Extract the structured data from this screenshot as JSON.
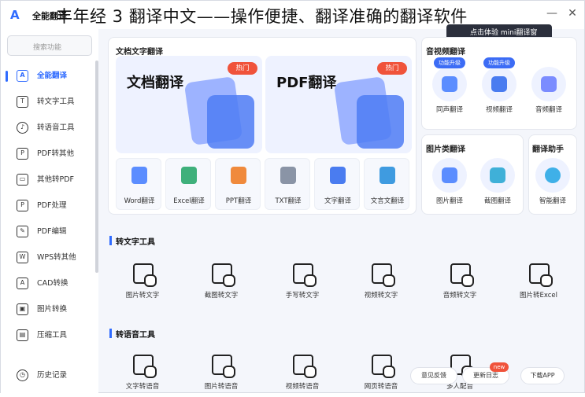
{
  "app": {
    "name": "全能翻译",
    "logo": "A",
    "overlay_title": "丰年经 3 翻译中文——操作便捷、翻译准确的翻译软件",
    "trial_label": "点击体验 mini翻译窗"
  },
  "window": {
    "minimize": "—",
    "close": "✕"
  },
  "sidebar": {
    "search_placeholder": "搜索功能",
    "items": [
      {
        "label": "全能翻译",
        "icon": "translate-icon"
      },
      {
        "label": "转文字工具",
        "icon": "text-tool-icon"
      },
      {
        "label": "转语音工具",
        "icon": "voice-icon"
      },
      {
        "label": "PDF转其他",
        "icon": "pdf-icon"
      },
      {
        "label": "其他转PDF",
        "icon": "file-to-pdf-icon"
      },
      {
        "label": "PDF处理",
        "icon": "pdf-process-icon"
      },
      {
        "label": "PDF编辑",
        "icon": "pdf-edit-icon"
      },
      {
        "label": "WPS转其他",
        "icon": "wps-icon"
      },
      {
        "label": "CAD转换",
        "icon": "cad-icon"
      },
      {
        "label": "图片转换",
        "icon": "image-icon"
      },
      {
        "label": "压缩工具",
        "icon": "compress-icon"
      },
      {
        "label": "历史记录",
        "icon": "history-icon"
      }
    ]
  },
  "doc_panel": {
    "title": "文档文字翻译",
    "cards": [
      {
        "title": "文档翻译",
        "badge": "热门"
      },
      {
        "title": "PDF翻译",
        "badge": "热门"
      }
    ],
    "tools": [
      "Word翻译",
      "Excel翻译",
      "PPT翻译",
      "TXT翻译",
      "文字翻译",
      "文言文翻译"
    ]
  },
  "av_panel": {
    "title": "音视频翻译",
    "items": [
      {
        "label": "同声翻译",
        "tag": "功能升级"
      },
      {
        "label": "视频翻译",
        "tag": "功能升级"
      },
      {
        "label": "音频翻译",
        "tag": ""
      }
    ]
  },
  "img_panel": {
    "title": "图片类翻译",
    "items": [
      "图片翻译",
      "截图翻译"
    ]
  },
  "assist_panel": {
    "title": "翻译助手",
    "items": [
      "智能翻译"
    ]
  },
  "section_text": {
    "title": "转文字工具",
    "items": [
      "图片转文字",
      "截图转文字",
      "手写转文字",
      "视频转文字",
      "音频转文字",
      "图片转Excel"
    ]
  },
  "section_voice": {
    "title": "转语音工具",
    "items": [
      "文字转语音",
      "图片转语音",
      "视频转语音",
      "网页转语音",
      "多人配音"
    ]
  },
  "footer": {
    "feedback": "意见反馈",
    "log": "更新日志",
    "new_badge": "new",
    "download": "下载APP"
  },
  "colors": {
    "accent": "#2f6bff",
    "hot": "#f0533b",
    "tag": "#3c6cf5"
  }
}
